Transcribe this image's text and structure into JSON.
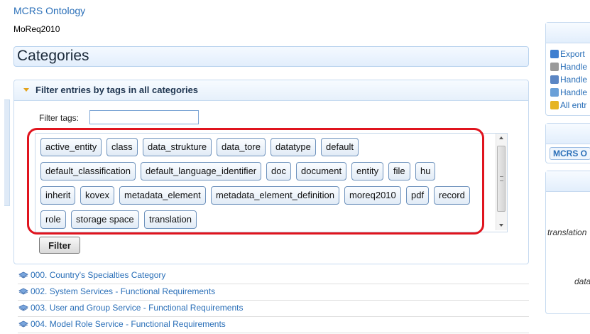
{
  "header": {
    "app_link": "MCRS Ontology",
    "subtitle": "MoReq2010"
  },
  "page_title": "Categories",
  "filter_panel": {
    "title": "Filter entries by tags in all categories",
    "filter_label": "Filter tags:",
    "filter_value": "",
    "tags": [
      "active_entity",
      "class",
      "data_strukture",
      "data_tore",
      "datatype",
      "default",
      "default_classification",
      "default_language_identifier",
      "doc",
      "document",
      "entity",
      "file",
      "hu",
      "inherit",
      "kovex",
      "metadata_element",
      "metadata_element_definition",
      "moreq2010",
      "pdf",
      "record",
      "role",
      "storage space",
      "translation"
    ],
    "button_label": "Filter"
  },
  "categories": [
    "000. Country's Specialties Category",
    "002. System Services - Functional Requirements",
    "003. User and Group Service - Functional Requirements",
    "004. Model Role Service - Functional Requirements"
  ],
  "right_panel": {
    "actions": [
      {
        "label": "Export",
        "icon": "export-icon"
      },
      {
        "label": "Handle",
        "icon": "paperclip-icon"
      },
      {
        "label": "Handle",
        "icon": "envelope-icon"
      },
      {
        "label": "Handle",
        "icon": "tag-icon"
      },
      {
        "label": "All entr",
        "icon": "folder-icon"
      }
    ],
    "tab_label": "MCRS O",
    "text_translation": "translation",
    "text_data": "data"
  },
  "colors": {
    "link": "#2a6fb8",
    "highlight": "#e0141e",
    "panel_border": "#c6daf0"
  }
}
